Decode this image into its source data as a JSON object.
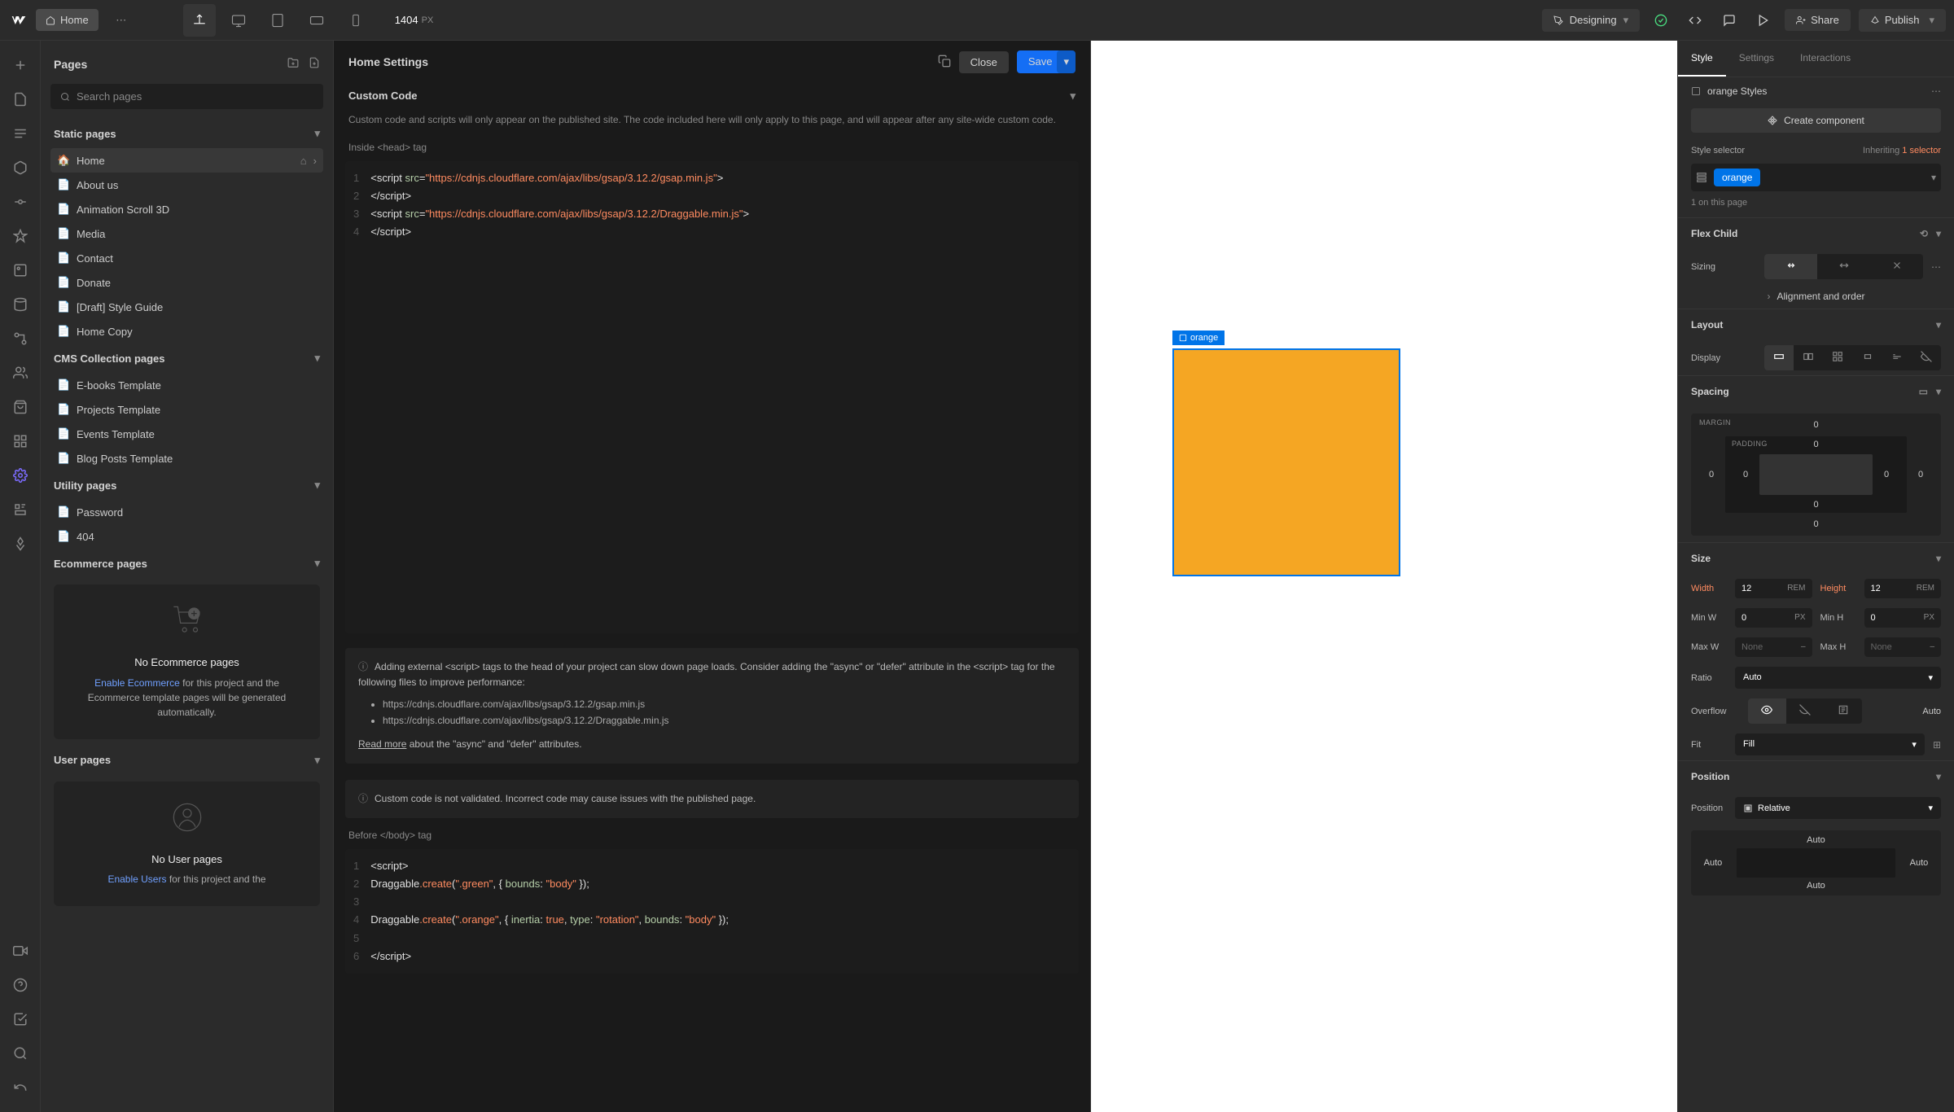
{
  "topbar": {
    "home_label": "Home",
    "dimensions": "1404",
    "dimensions_unit": "PX",
    "designing": "Designing",
    "share": "Share",
    "publish": "Publish"
  },
  "left_panel": {
    "title": "Pages",
    "search_placeholder": "Search pages",
    "static_header": "Static pages",
    "static_pages": [
      "Home",
      "About us",
      "Animation Scroll 3D",
      "Media",
      "Contact",
      "Donate",
      "[Draft] Style Guide",
      "Home Copy"
    ],
    "cms_header": "CMS Collection pages",
    "cms_pages": [
      "E-books Template",
      "Projects Template",
      "Events Template",
      "Blog Posts Template"
    ],
    "utility_header": "Utility pages",
    "utility_pages": [
      "Password",
      "404"
    ],
    "ecom_header": "Ecommerce pages",
    "ecom_empty_title": "No Ecommerce pages",
    "ecom_empty_link": "Enable Ecommerce",
    "ecom_empty_text": " for this project and the Ecommerce template pages will be generated automatically.",
    "user_header": "User pages",
    "user_empty_title": "No User pages",
    "user_empty_link": "Enable Users",
    "user_empty_text": " for this project and the"
  },
  "settings": {
    "title": "Home Settings",
    "close": "Close",
    "save": "Save",
    "custom_code": "Custom Code",
    "desc": "Custom code and scripts will only appear on the published site. The code included here will only apply to this page, and will appear after any site-wide custom code.",
    "head_label": "Inside <head> tag",
    "body_label": "Before </body> tag",
    "head_code_lines": [
      "1",
      "2",
      "3",
      "4"
    ],
    "head_code_text": "<script src=\"https://cdnjs.cloudflare.com/ajax/libs/gsap/3.12.2/gsap.min.js\">\n</script>\n<script src=\"https://cdnjs.cloudflare.com/ajax/libs/gsap/3.12.2/Draggable.min.js\">\n</script>",
    "body_code_lines": [
      "1",
      "2",
      "3",
      "4",
      "5",
      "6"
    ],
    "warn_text": "Adding external <script> tags to the head of your project can slow down page loads. Consider adding the \"async\" or \"defer\" attribute in the <script> tag for the following files to improve performance:",
    "warn_file1": "https://cdnjs.cloudflare.com/ajax/libs/gsap/3.12.2/gsap.min.js",
    "warn_file2": "https://cdnjs.cloudflare.com/ajax/libs/gsap/3.12.2/Draggable.min.js",
    "read_more": "Read more",
    "read_more_tail": " about the \"async\" and \"defer\" attributes.",
    "warn2": "Custom code is not validated. Incorrect code may cause issues with the published page."
  },
  "canvas": {
    "element_name": "orange"
  },
  "right": {
    "tabs": [
      "Style",
      "Settings",
      "Interactions"
    ],
    "style_name": "orange Styles",
    "create_component": "Create component",
    "selector_label": "Style selector",
    "inheriting": "Inheriting ",
    "inherit_num": "1 selector",
    "selector_tag": "orange",
    "on_page": "1 on this page",
    "flex_child": "Flex Child",
    "sizing": "Sizing",
    "alignment": "Alignment and order",
    "layout": "Layout",
    "display": "Display",
    "spacing": "Spacing",
    "margin_label": "MARGIN",
    "padding_label": "PADDING",
    "sp_zero": "0",
    "size": "Size",
    "width": "Width",
    "width_val": "12",
    "width_unit": "REM",
    "height": "Height",
    "height_val": "12",
    "height_unit": "REM",
    "min_w": "Min W",
    "min_w_val": "0",
    "px_unit": "PX",
    "min_h": "Min H",
    "min_h_val": "0",
    "max_w": "Max W",
    "none": "None",
    "max_h": "Max H",
    "ratio": "Ratio",
    "auto": "Auto",
    "overflow": "Overflow",
    "fit": "Fit",
    "fill": "Fill",
    "position": "Position",
    "position_label": "Position",
    "relative": "Relative"
  }
}
